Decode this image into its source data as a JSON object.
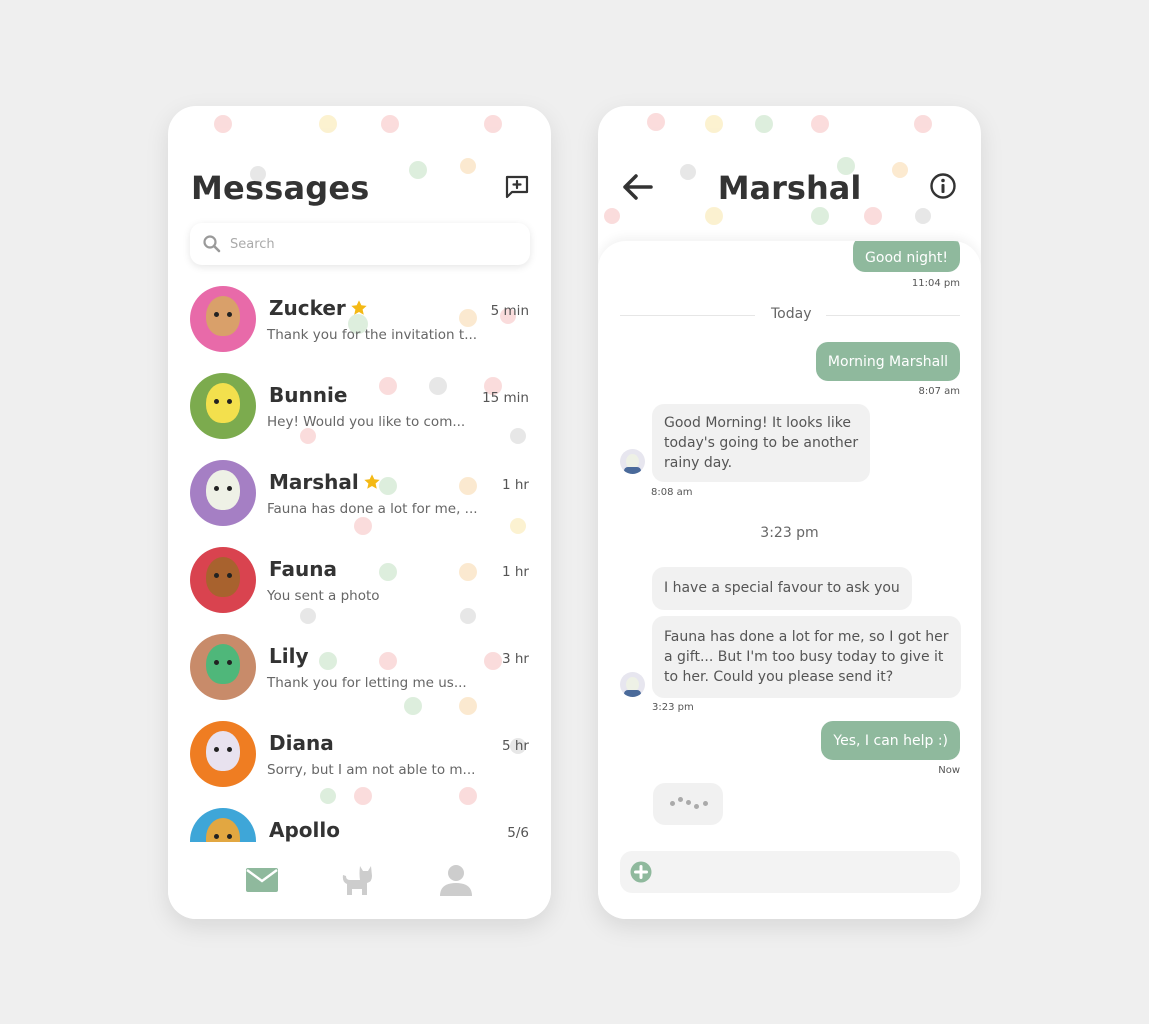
{
  "colors": {
    "accent": "#8fb99d",
    "star": "#f4b915",
    "bubble_in": "#f1f1f1",
    "tab_inactive": "#cdcdcd"
  },
  "list": {
    "title": "Messages",
    "compose_icon": "compose-icon",
    "search": {
      "placeholder": "Search",
      "icon": "search-icon"
    },
    "conversations": [
      {
        "name": "Zucker",
        "starred": true,
        "preview": "Thank you for the invitation t...",
        "time": "5 min"
      },
      {
        "name": "Bunnie",
        "starred": false,
        "preview": "Hey! Would you like to com...",
        "time": "15 min"
      },
      {
        "name": "Marshal",
        "starred": true,
        "preview": "Fauna has done a lot for me, ...",
        "time": "1 hr"
      },
      {
        "name": "Fauna",
        "starred": false,
        "preview": "You sent a photo",
        "time": "1 hr"
      },
      {
        "name": "Lily",
        "starred": false,
        "preview": "Thank you for letting me us...",
        "time": "3 hr"
      },
      {
        "name": "Diana",
        "starred": false,
        "preview": "Sorry, but I am not able to m...",
        "time": "5 hr"
      },
      {
        "name": "Apollo",
        "starred": false,
        "preview": "",
        "time": "5/6"
      }
    ],
    "tabs": [
      "mail-icon",
      "cat-icon",
      "profile-icon"
    ]
  },
  "chat": {
    "title": "Marshal",
    "back_icon": "back-arrow-icon",
    "info_icon": "info-icon",
    "messages": {
      "m1": {
        "text": "Good night!",
        "time": "11:04 pm"
      },
      "divider": "Today",
      "m2": {
        "text": "Morning Marshall",
        "time": "8:07 am"
      },
      "m3": {
        "lines": [
          "Good Morning! It looks like",
          "today's going to be another",
          "rainy day."
        ],
        "time": "8:08 am"
      },
      "center_time": "3:23 pm",
      "m4": {
        "text": "I have a special favour to ask you"
      },
      "m5": {
        "lines": [
          "Fauna has done a lot for me, so I got her",
          "a gift... But I'm too busy today to give it",
          "to her. Could you please send it?"
        ],
        "time": "3:23 pm"
      },
      "m6": {
        "text": "Yes, I can help :)",
        "time": "Now"
      }
    },
    "composer_icon": "add-circle-icon"
  }
}
